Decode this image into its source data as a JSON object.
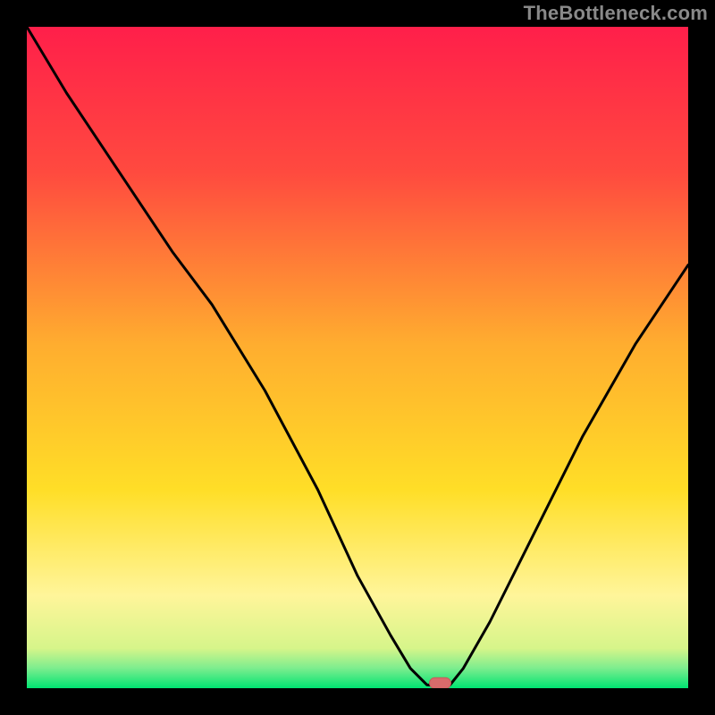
{
  "watermark": "TheBottleneck.com",
  "colors": {
    "frame": "#000000",
    "top_gradient": "#ff1f4a",
    "mid1_gradient": "#ff7a3a",
    "mid2_gradient": "#ffd400",
    "band_gradient": "#ffffa0",
    "bottom_gradient": "#00e472",
    "curve": "#000000",
    "marker_fill": "#d86b6b",
    "marker_stroke": "#c45a5a"
  },
  "chart_data": {
    "type": "line",
    "title": "",
    "xlabel": "",
    "ylabel": "",
    "xlim": [
      0,
      100
    ],
    "ylim": [
      0,
      100
    ],
    "series": [
      {
        "name": "bottleneck-curve",
        "x": [
          0,
          6,
          14,
          22,
          28,
          36,
          44,
          50,
          55,
          58,
          60.5,
          62.5,
          64,
          66,
          70,
          76,
          84,
          92,
          100
        ],
        "values": [
          100,
          90,
          78,
          66,
          58,
          45,
          30,
          17,
          8,
          3,
          0.5,
          0.3,
          0.5,
          3,
          10,
          22,
          38,
          52,
          64
        ]
      }
    ],
    "marker": {
      "x": 62.5,
      "y": 0.5
    },
    "annotations": []
  }
}
